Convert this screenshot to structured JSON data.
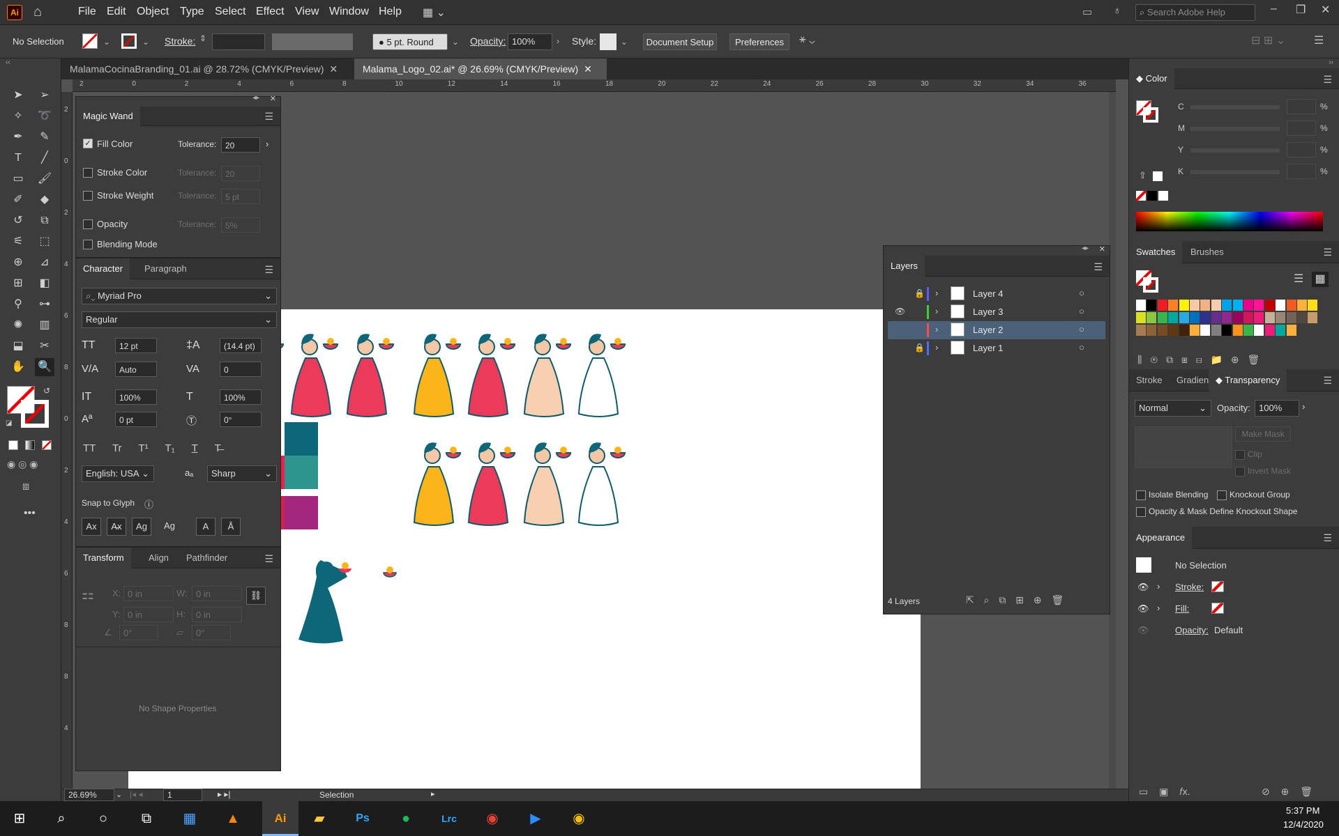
{
  "app": {
    "logo": "Ai",
    "menus": [
      "File",
      "Edit",
      "Object",
      "Type",
      "Select",
      "Effect",
      "View",
      "Window",
      "Help"
    ],
    "search_placeholder": "Search Adobe Help"
  },
  "control": {
    "selection": "No Selection",
    "stroke_label": "Stroke:",
    "brush": "5 pt. Round",
    "opacity_label": "Opacity:",
    "opacity": "100%",
    "style_label": "Style:",
    "doc_setup": "Document Setup",
    "preferences": "Preferences"
  },
  "tabs": [
    {
      "label": "MalamaCocinaBranding_01.ai @ 28.72% (CMYK/Preview)"
    },
    {
      "label": "Malama_Logo_02.ai* @ 26.69% (CMYK/Preview)"
    }
  ],
  "ruler": [
    "2",
    "0",
    "2",
    "4",
    "6",
    "8",
    "10",
    "12",
    "14",
    "16",
    "18",
    "20",
    "22",
    "24",
    "26",
    "28",
    "30",
    "32",
    "34",
    "36"
  ],
  "vruler": [
    "2",
    "0",
    "2",
    "4",
    "6",
    "8",
    "0",
    "2",
    "4",
    "6",
    "8",
    "8",
    "4"
  ],
  "magic_wand": {
    "title": "Magic Wand",
    "fill": "Fill Color",
    "stroke": "Stroke Color",
    "weight": "Stroke Weight",
    "opacity": "Opacity",
    "blend": "Blending Mode",
    "tol": "Tolerance:",
    "tol_fill": "20",
    "tol_stroke": "20",
    "tol_weight": "5 pt",
    "tol_opacity": "5%"
  },
  "character": {
    "tab1": "Character",
    "tab2": "Paragraph",
    "font": "Myriad Pro",
    "style": "Regular",
    "size": "12 pt",
    "leading": "(14.4 pt)",
    "kerning": "Auto",
    "tracking": "0",
    "vscale": "100%",
    "hscale": "100%",
    "baseline": "0 pt",
    "rotate": "0°",
    "lang": "English: USA",
    "aa": "Sharp",
    "snap": "Snap to Glyph"
  },
  "transform": {
    "tab1": "Transform",
    "tab2": "Align",
    "tab3": "Pathfinder",
    "x": "0 in",
    "y": "0 in",
    "w": "0 in",
    "h": "0 in",
    "angle": "0°",
    "shear": "0°",
    "x_label": "X:",
    "y_label": "Y:",
    "w_label": "W:",
    "h_label": "H:",
    "empty": "No Shape Properties"
  },
  "layers": {
    "title": "Layers",
    "items": [
      "Layer 4",
      "Layer 3",
      "Layer 2",
      "Layer 1"
    ],
    "colors": [
      "#5b5bff",
      "#3cd03c",
      "#ff4d4d",
      "#4d6bff"
    ],
    "count": "4 Layers"
  },
  "color": {
    "title": "Color",
    "channels": [
      "C",
      "M",
      "Y",
      "K"
    ],
    "pct": "%"
  },
  "swatches": {
    "tab1": "Swatches",
    "tab2": "Brushes",
    "colors": [
      "#ffffff",
      "#000000",
      "#ee1c24",
      "#ff7f27",
      "#fff200",
      "#f7c8a4",
      "#f4b183",
      "#f8cbad",
      "#00a2e8",
      "#00b0f0",
      "#ec008c",
      "#ff1493",
      "#c00000",
      "#fff",
      "#f15a24",
      "#fbb03b",
      "#ffde17",
      "#d9e021",
      "#8cc63f",
      "#39b54a",
      "#00a99d",
      "#29abe2",
      "#0071bc",
      "#2e3192",
      "#662d91",
      "#93278f",
      "#9e005d",
      "#d4145a",
      "#ed1e79",
      "#c7b299",
      "#998675",
      "#736357",
      "#534741",
      "#c69c6d",
      "#a67c52",
      "#8c6239",
      "#754c24",
      "#603813",
      "#42210b",
      "#fbb03b",
      "#fff",
      "#808080",
      "#000",
      "#f7931e",
      "#39b54a",
      "#fff",
      "#ed1e79",
      "#00a99d",
      "#fbb03b"
    ]
  },
  "transparency": {
    "tab1": "Stroke",
    "tab2": "Gradient",
    "tab3": "Transparency",
    "mode": "Normal",
    "opacity_label": "Opacity:",
    "opacity": "100%",
    "make_mask": "Make Mask",
    "clip": "Clip",
    "invert": "Invert Mask",
    "isolate": "Isolate Blending",
    "knockout": "Knockout Group",
    "define": "Opacity & Mask Define Knockout Shape"
  },
  "appearance": {
    "title": "Appearance",
    "sel": "No Selection",
    "stroke": "Stroke:",
    "fill": "Fill:",
    "opacity": "Opacity:",
    "opacity_val": "Default"
  },
  "status": {
    "zoom": "26.69%",
    "page": "1",
    "tool": "Selection"
  },
  "taskbar": {
    "time": "5:37 PM",
    "date": "12/4/2020"
  },
  "palette": {
    "row1": [
      "#fdd28a",
      "#f5935e",
      "#ef6a4b",
      "#ec1e4a",
      "#2d958d"
    ],
    "row2": [
      "#fbb51a",
      "#f47f20",
      "#ef4723",
      "#d61f4d",
      "#a3277f"
    ],
    "top": "#0e6679",
    "teal": "#0e6679"
  }
}
